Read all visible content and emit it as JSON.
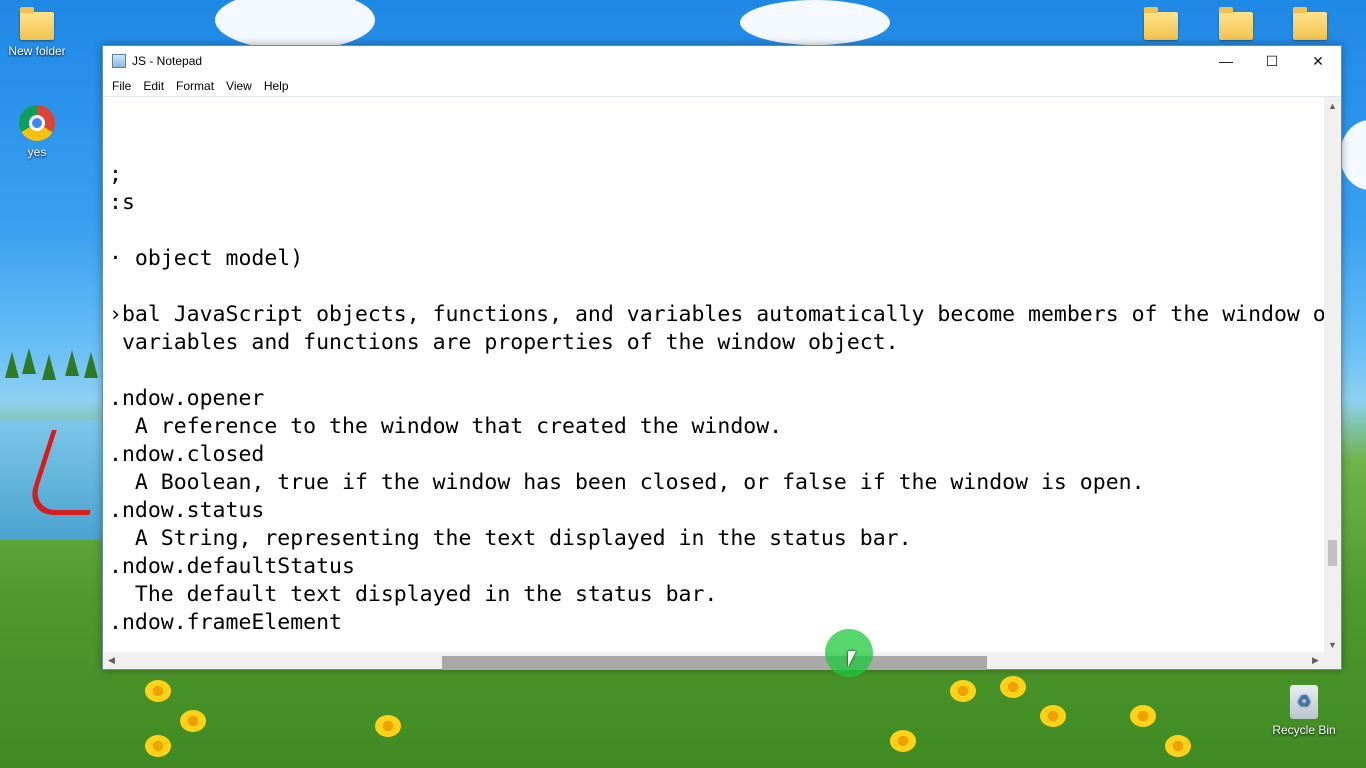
{
  "desktop": {
    "icons": [
      {
        "label": "New folder"
      },
      {
        "label": "yes"
      },
      {
        "label": "Recycle Bin"
      }
    ]
  },
  "window": {
    "title": "JS - Notepad",
    "controls": {
      "minimize": "—",
      "maximize": "☐",
      "close": "✕"
    }
  },
  "menu": [
    "File",
    "Edit",
    "Format",
    "View",
    "Help"
  ],
  "editor": {
    "lines": [
      "",
      "",
      ";",
      ":s",
      "",
      "· object model)",
      "",
      "›bal JavaScript objects, functions, and variables automatically become members of the window o",
      " variables and functions are properties of the window object.",
      "",
      ".ndow.opener",
      "  A reference to the window that created the window.",
      ".ndow.closed",
      "  A Boolean, true if the window has been closed, or false if the window is open.",
      ".ndow.status",
      "  A String, representing the text displayed in the status bar.",
      ".ndow.defaultStatus",
      "  The default text displayed in the status bar.",
      ".ndow.frameElement"
    ]
  },
  "scrollbars": {
    "vertical": {
      "up_icon": "up-arrow-icon",
      "down_icon": "down-arrow-icon",
      "position": 0.8
    },
    "horizontal": {
      "left_icon": "left-arrow-icon",
      "right_icon": "right-arrow-icon",
      "position": 0.45
    }
  }
}
